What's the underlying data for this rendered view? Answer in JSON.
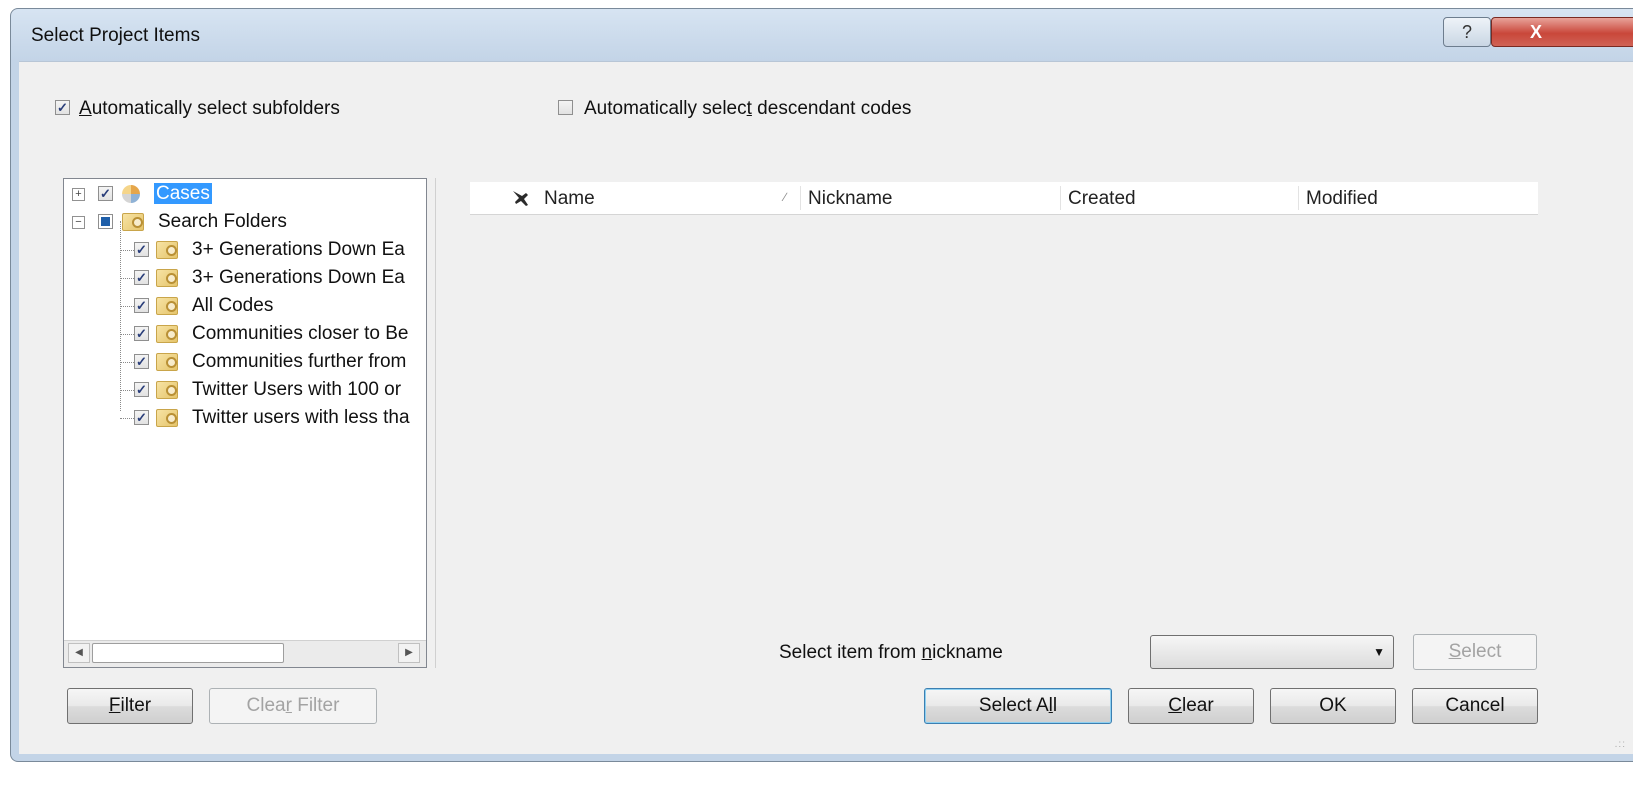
{
  "window": {
    "title": "Select Project Items",
    "help_label": "?",
    "close_label": "X"
  },
  "options": {
    "auto_subfolders": {
      "label_pre": "",
      "label_u": "A",
      "label_post": "utomatically select subfolders",
      "checked": true
    },
    "auto_descendants": {
      "label_pre": "Automatically selec",
      "label_u": "t",
      "label_post": " descendant codes",
      "checked": false
    }
  },
  "tree": {
    "cases": {
      "label": "Cases",
      "expander": "+",
      "checked": true
    },
    "search_folders": {
      "label": "Search Folders",
      "expander": "−"
    },
    "children": [
      {
        "label": "3+ Generations Down Ea"
      },
      {
        "label": "3+ Generations Down Ea"
      },
      {
        "label": "All Codes"
      },
      {
        "label": "Communities closer to Be"
      },
      {
        "label": "Communities further from"
      },
      {
        "label": "Twitter Users with 100 or"
      },
      {
        "label": "Twitter users with less tha"
      }
    ],
    "scroll_left": "◀",
    "scroll_right": "▶"
  },
  "grid": {
    "columns": [
      "Name",
      "Nickname",
      "Created",
      "Modified"
    ],
    "sort_glyph": "∕"
  },
  "nickname": {
    "label_pre": "Select item from ",
    "label_u": "n",
    "label_post": "ickname",
    "value": "",
    "dropdown_glyph": "▼",
    "select_button_u": "S",
    "select_button_post": "elect"
  },
  "buttons": {
    "filter_u": "F",
    "filter_post": "ilter",
    "clear_filter_pre": "Clea",
    "clear_filter_u": "r",
    "clear_filter_post": " Filter",
    "select_all_pre": "Select A",
    "select_all_u": "l",
    "select_all_post": "l",
    "clear_u": "C",
    "clear_post": "lear",
    "ok": "OK",
    "cancel": "Cancel"
  },
  "colors": {
    "selection": "#3399ff",
    "close_button": "#c9473a",
    "dialog_frame": "#c3d4e7",
    "client_bg": "#f0f0f0"
  }
}
